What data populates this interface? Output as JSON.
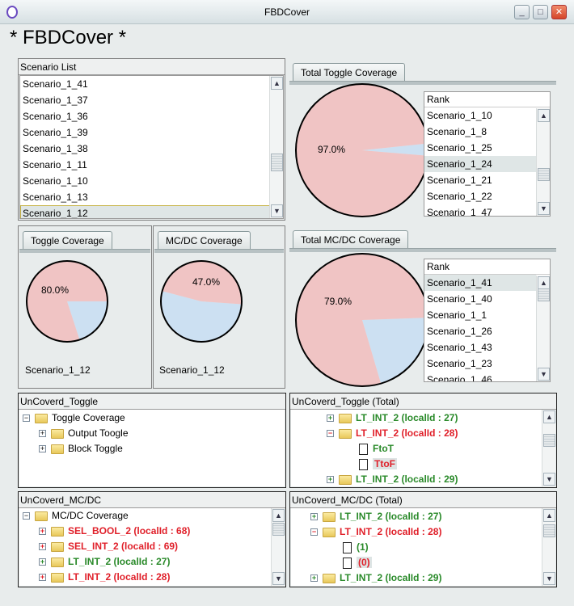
{
  "window": {
    "title": "FBDCover",
    "heading": "* FBDCover *"
  },
  "colors": {
    "covered": "#f0c4c4",
    "uncovered": "#cce0f2",
    "covered_text": "#2a8a2a",
    "uncovered_text": "#e0202a"
  },
  "scenario_list": {
    "title": "Scenario List",
    "items": [
      "Scenario_1_41",
      "Scenario_1_37",
      "Scenario_1_36",
      "Scenario_1_39",
      "Scenario_1_38",
      "Scenario_1_11",
      "Scenario_1_10",
      "Scenario_1_13",
      "Scenario_1_12"
    ],
    "selected": "Scenario_1_12"
  },
  "total_toggle": {
    "tab": "Total Toggle Coverage",
    "percent_label": "97.0%",
    "covered_pct": 97.0,
    "rank_title": "Rank",
    "rank": [
      "Scenario_1_10",
      "Scenario_1_8",
      "Scenario_1_25",
      "Scenario_1_24",
      "Scenario_1_21",
      "Scenario_1_22",
      "Scenario_1_47"
    ],
    "selected": "Scenario_1_24"
  },
  "toggle": {
    "tab": "Toggle Coverage",
    "percent_label": "80.0%",
    "covered_pct": 80.0,
    "scenario": "Scenario_1_12"
  },
  "mcdc": {
    "tab": "MC/DC Coverage",
    "percent_label": "47.0%",
    "covered_pct": 47.0,
    "scenario": "Scenario_1_12"
  },
  "total_mcdc": {
    "tab": "Total MC/DC Coverage",
    "percent_label": "79.0%",
    "covered_pct": 79.0,
    "rank_title": "Rank",
    "rank": [
      "Scenario_1_41",
      "Scenario_1_40",
      "Scenario_1_1",
      "Scenario_1_26",
      "Scenario_1_43",
      "Scenario_1_23",
      "Scenario_1_46"
    ],
    "selected": "Scenario_1_41"
  },
  "uncov_toggle": {
    "title": "UnCoverd_Toggle",
    "root": "Toggle Coverage",
    "children": [
      "Output Toogle",
      "Block Toggle"
    ]
  },
  "uncov_toggle_total": {
    "title": "UnCoverd_Toggle (Total)",
    "n1": "LT_INT_2 (localId : 27)",
    "n2": "LT_INT_2 (localId : 28)",
    "l1": "FtoT",
    "l2": "TtoF",
    "n3": "LT_INT_2 (localId : 29)"
  },
  "uncov_mcdc": {
    "title": "UnCoverd_MC/DC",
    "root": "MC/DC Coverage",
    "children": [
      "SEL_BOOL_2 (localId : 68)",
      "SEL_INT_2 (localId : 69)",
      "LT_INT_2 (localId : 27)",
      "LT_INT_2 (localId : 28)"
    ]
  },
  "uncov_mcdc_total": {
    "title": "UnCoverd_MC/DC (Total)",
    "n1": "LT_INT_2 (localId : 27)",
    "n2": "LT_INT_2 (localId : 28)",
    "l1": "(1)",
    "l2": "(0)",
    "n3": "LT_INT_2 (localId : 29)"
  }
}
